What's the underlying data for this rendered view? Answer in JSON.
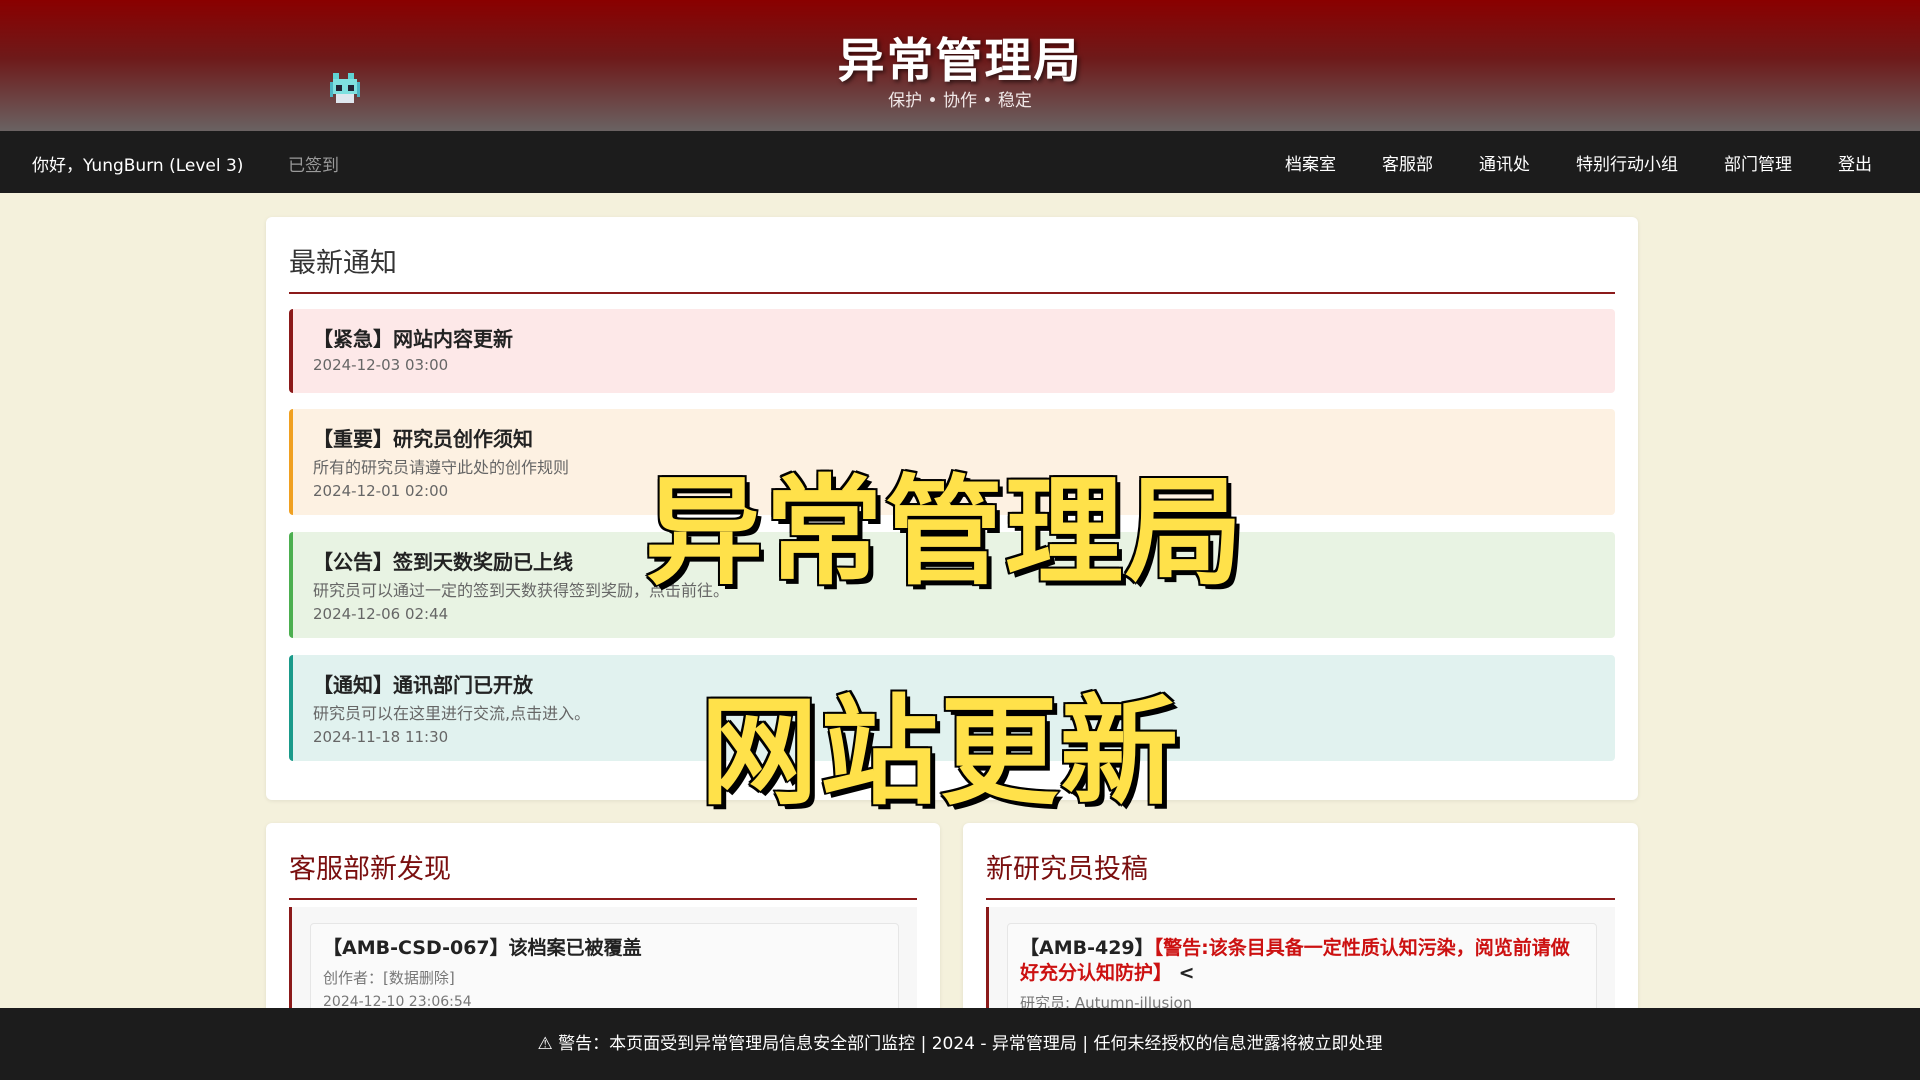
{
  "header": {
    "title": "异常管理局",
    "subtitle": "保护 • 协作 • 稳定"
  },
  "nav": {
    "greeting": "你好，YungBurn (Level 3)",
    "checkin_status": "已签到",
    "links": [
      "档案室",
      "客服部",
      "通讯处",
      "特别行动小组",
      "部门管理",
      "登出"
    ]
  },
  "notices": {
    "heading": "最新通知",
    "items": [
      {
        "title": "【紧急】网站内容更新",
        "desc": "",
        "date": "2024-12-03 03:00",
        "color": "#8b1a1a"
      },
      {
        "title": "【重要】研究员创作须知",
        "desc": "所有的研究员请遵守此处的创作规则",
        "date": "2024-12-01 02:00",
        "color": "#f0a020"
      },
      {
        "title": "【公告】签到天数奖励已上线",
        "desc": "研究员可以通过一定的签到天数获得签到奖励，点击前往。",
        "date": "2024-12-06 02:44",
        "color": "#4caf50"
      },
      {
        "title": "【通知】通讯部门已开放",
        "desc": "研究员可以在这里进行交流,点击进入。",
        "date": "2024-11-18 11:30",
        "color": "#1a9a8a"
      }
    ]
  },
  "customer_service": {
    "heading": "客服部新发现",
    "card": {
      "title": "【AMB-CSD-067】该档案已被覆盖",
      "author": "创作者：[数据删除]",
      "date": "2024-12-10 23:06:54"
    }
  },
  "submissions": {
    "heading": "新研究员投稿",
    "card": {
      "title_prefix": "【AMB-429】",
      "warning": "【警告:该条目具备一定性质认知污染，阅览前请做好充分认知防护】",
      "title_suffix": " <",
      "researcher": "研究员: Autumn-illusion"
    }
  },
  "footer": {
    "text": "⚠ 警告：本页面受到异常管理局信息安全部门监控 | 2024 - 异常管理局 | 任何未经授权的信息泄露将被立即处理"
  },
  "overlay": {
    "line1": "异常管理局",
    "line2": "网站更新"
  },
  "colors": {
    "brand": "#8b1a1a",
    "background": "#f4f1dc",
    "overlay_text": "#ffe14a"
  },
  "icons": {
    "mascot": "pixel-mascot-icon",
    "warning": "warning-icon"
  }
}
